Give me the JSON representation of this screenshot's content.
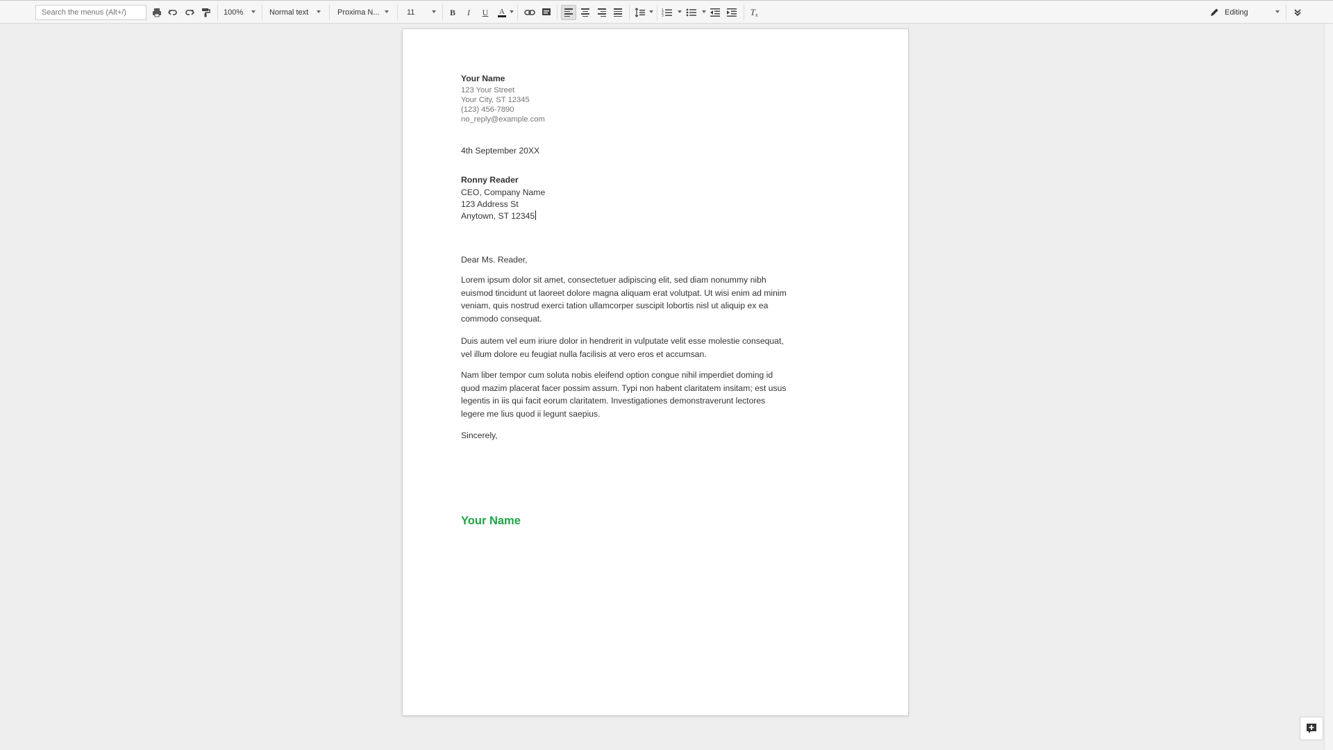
{
  "toolbar": {
    "search_placeholder": "Search the menus (Alt+/)",
    "zoom": "100%",
    "style": "Normal text",
    "font": "Proxima N...",
    "font_size": "11",
    "text_color": "#222222",
    "mode_label": "Editing"
  },
  "document": {
    "sender": {
      "name": "Your Name",
      "street": "123 Your Street",
      "city": "Your City, ST 12345",
      "phone": "(123) 456-7890",
      "email": "no_reply@example.com"
    },
    "date": "4th September 20XX",
    "recipient": {
      "name": "Ronny Reader",
      "title": "CEO, Company Name",
      "street": "123 Address St",
      "city": "Anytown, ST 12345"
    },
    "salutation": "Dear Ms. Reader,",
    "paragraphs": [
      "Lorem ipsum dolor sit amet, consectetuer adipiscing elit, sed diam nonummy nibh euismod tincidunt ut laoreet dolore magna aliquam erat volutpat. Ut wisi enim ad minim veniam, quis nostrud exerci tation ullamcorper suscipit lobortis nisl ut aliquip ex ea commodo consequat.",
      "Duis autem vel eum iriure dolor in hendrerit in vulputate velit esse molestie consequat, vel illum dolore eu feugiat nulla facilisis at vero eros et accumsan.",
      "Nam liber tempor cum soluta nobis eleifend option congue nihil imperdiet doming id quod mazim placerat facer possim assum. Typi non habent claritatem insitam; est usus legentis in iis qui facit eorum claritatem. Investigationes demonstraverunt lectores legere me lius quod ii legunt saepius."
    ],
    "closing": "Sincerely,",
    "signature": "Your Name",
    "signature_color": "#1ea446"
  }
}
